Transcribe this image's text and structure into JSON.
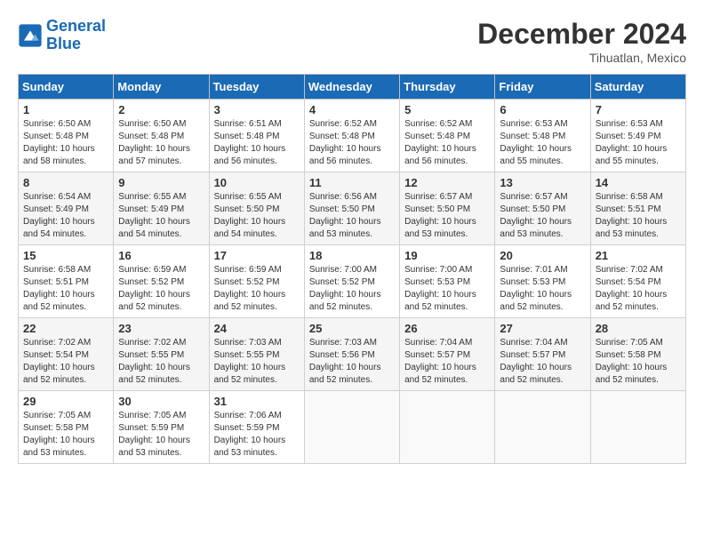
{
  "header": {
    "logo_line1": "General",
    "logo_line2": "Blue",
    "month": "December 2024",
    "location": "Tihuatlan, Mexico"
  },
  "weekdays": [
    "Sunday",
    "Monday",
    "Tuesday",
    "Wednesday",
    "Thursday",
    "Friday",
    "Saturday"
  ],
  "weeks": [
    [
      {
        "day": "1",
        "sunrise": "6:50 AM",
        "sunset": "5:48 PM",
        "daylight": "10 hours and 58 minutes."
      },
      {
        "day": "2",
        "sunrise": "6:50 AM",
        "sunset": "5:48 PM",
        "daylight": "10 hours and 57 minutes."
      },
      {
        "day": "3",
        "sunrise": "6:51 AM",
        "sunset": "5:48 PM",
        "daylight": "10 hours and 56 minutes."
      },
      {
        "day": "4",
        "sunrise": "6:52 AM",
        "sunset": "5:48 PM",
        "daylight": "10 hours and 56 minutes."
      },
      {
        "day": "5",
        "sunrise": "6:52 AM",
        "sunset": "5:48 PM",
        "daylight": "10 hours and 56 minutes."
      },
      {
        "day": "6",
        "sunrise": "6:53 AM",
        "sunset": "5:48 PM",
        "daylight": "10 hours and 55 minutes."
      },
      {
        "day": "7",
        "sunrise": "6:53 AM",
        "sunset": "5:49 PM",
        "daylight": "10 hours and 55 minutes."
      }
    ],
    [
      {
        "day": "8",
        "sunrise": "6:54 AM",
        "sunset": "5:49 PM",
        "daylight": "10 hours and 54 minutes."
      },
      {
        "day": "9",
        "sunrise": "6:55 AM",
        "sunset": "5:49 PM",
        "daylight": "10 hours and 54 minutes."
      },
      {
        "day": "10",
        "sunrise": "6:55 AM",
        "sunset": "5:50 PM",
        "daylight": "10 hours and 54 minutes."
      },
      {
        "day": "11",
        "sunrise": "6:56 AM",
        "sunset": "5:50 PM",
        "daylight": "10 hours and 53 minutes."
      },
      {
        "day": "12",
        "sunrise": "6:57 AM",
        "sunset": "5:50 PM",
        "daylight": "10 hours and 53 minutes."
      },
      {
        "day": "13",
        "sunrise": "6:57 AM",
        "sunset": "5:50 PM",
        "daylight": "10 hours and 53 minutes."
      },
      {
        "day": "14",
        "sunrise": "6:58 AM",
        "sunset": "5:51 PM",
        "daylight": "10 hours and 53 minutes."
      }
    ],
    [
      {
        "day": "15",
        "sunrise": "6:58 AM",
        "sunset": "5:51 PM",
        "daylight": "10 hours and 52 minutes."
      },
      {
        "day": "16",
        "sunrise": "6:59 AM",
        "sunset": "5:52 PM",
        "daylight": "10 hours and 52 minutes."
      },
      {
        "day": "17",
        "sunrise": "6:59 AM",
        "sunset": "5:52 PM",
        "daylight": "10 hours and 52 minutes."
      },
      {
        "day": "18",
        "sunrise": "7:00 AM",
        "sunset": "5:52 PM",
        "daylight": "10 hours and 52 minutes."
      },
      {
        "day": "19",
        "sunrise": "7:00 AM",
        "sunset": "5:53 PM",
        "daylight": "10 hours and 52 minutes."
      },
      {
        "day": "20",
        "sunrise": "7:01 AM",
        "sunset": "5:53 PM",
        "daylight": "10 hours and 52 minutes."
      },
      {
        "day": "21",
        "sunrise": "7:02 AM",
        "sunset": "5:54 PM",
        "daylight": "10 hours and 52 minutes."
      }
    ],
    [
      {
        "day": "22",
        "sunrise": "7:02 AM",
        "sunset": "5:54 PM",
        "daylight": "10 hours and 52 minutes."
      },
      {
        "day": "23",
        "sunrise": "7:02 AM",
        "sunset": "5:55 PM",
        "daylight": "10 hours and 52 minutes."
      },
      {
        "day": "24",
        "sunrise": "7:03 AM",
        "sunset": "5:55 PM",
        "daylight": "10 hours and 52 minutes."
      },
      {
        "day": "25",
        "sunrise": "7:03 AM",
        "sunset": "5:56 PM",
        "daylight": "10 hours and 52 minutes."
      },
      {
        "day": "26",
        "sunrise": "7:04 AM",
        "sunset": "5:57 PM",
        "daylight": "10 hours and 52 minutes."
      },
      {
        "day": "27",
        "sunrise": "7:04 AM",
        "sunset": "5:57 PM",
        "daylight": "10 hours and 52 minutes."
      },
      {
        "day": "28",
        "sunrise": "7:05 AM",
        "sunset": "5:58 PM",
        "daylight": "10 hours and 52 minutes."
      }
    ],
    [
      {
        "day": "29",
        "sunrise": "7:05 AM",
        "sunset": "5:58 PM",
        "daylight": "10 hours and 53 minutes."
      },
      {
        "day": "30",
        "sunrise": "7:05 AM",
        "sunset": "5:59 PM",
        "daylight": "10 hours and 53 minutes."
      },
      {
        "day": "31",
        "sunrise": "7:06 AM",
        "sunset": "5:59 PM",
        "daylight": "10 hours and 53 minutes."
      },
      null,
      null,
      null,
      null
    ]
  ]
}
